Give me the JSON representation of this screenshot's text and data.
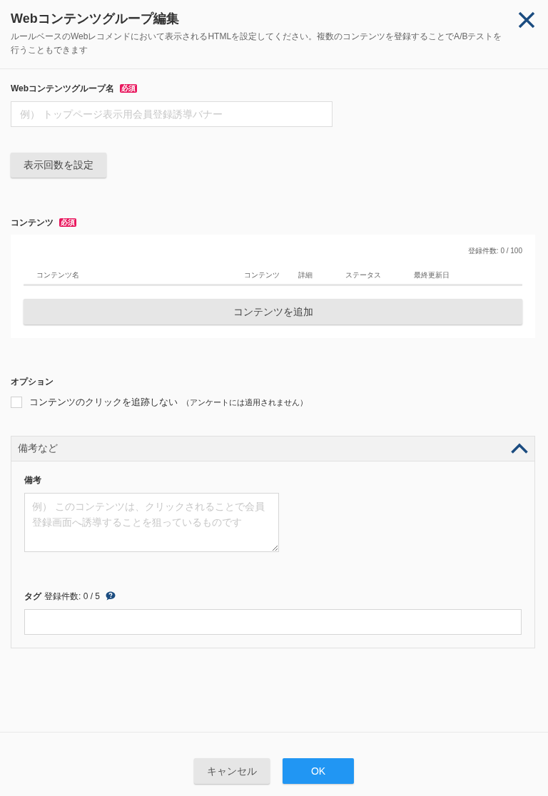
{
  "dialog": {
    "title": "Webコンテンツグループ編集",
    "description": "ルールベースのWebレコメンドにおいて表示されるHTMLを設定してください。複数のコンテンツを登録することでA/Bテストを行うこともできます"
  },
  "name_field": {
    "label": "Webコンテンツグループ名",
    "required_badge": "必須",
    "placeholder": "例） トップページ表示用会員登録誘導バナー"
  },
  "display_count_button": "表示回数を設定",
  "contents": {
    "label": "コンテンツ",
    "required_badge": "必須",
    "count": "登録件数: 0 / 100",
    "columns": [
      "コンテンツ名",
      "コンテンツ",
      "詳細",
      "ステータス",
      "最終更新日"
    ],
    "add_button": "コンテンツを追加"
  },
  "options": {
    "label": "オプション",
    "items": [
      {
        "label": "コンテンツのクリックを追跡しない",
        "note": "（アンケートには適用されません）",
        "checked": false
      }
    ]
  },
  "notes_panel": {
    "title": "備考など",
    "expanded": true,
    "memo": {
      "label": "備考",
      "placeholder": "例） このコンテンツは、クリックされることで会員登録画面へ誘導することを狙っているものです"
    },
    "tags": {
      "label": "タグ",
      "count": "登録件数: 0 / 5"
    }
  },
  "buttons": [
    {
      "label": "キャンセル",
      "kind": "secondary"
    },
    {
      "label": "OK",
      "kind": "primary"
    }
  ]
}
